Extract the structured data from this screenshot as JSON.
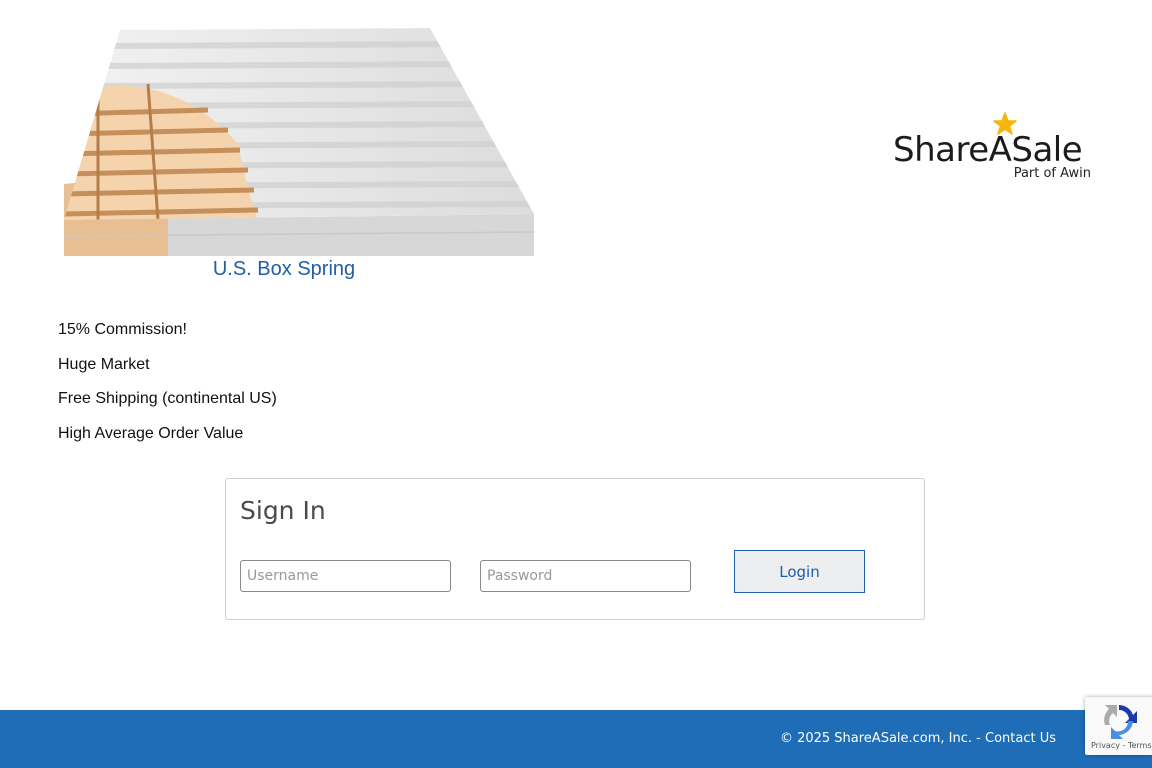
{
  "banner": {
    "caption": "U.S. Box Spring",
    "colors": {
      "caption": "#1f5fa8",
      "wood": "#e9c39b",
      "fabric": "#e3e3e3"
    }
  },
  "logo": {
    "name": "ShareASale",
    "subtitle": "Part of Awin",
    "icon": "star-icon",
    "colors": {
      "star": "#f5b50a",
      "text": "#1c1c1c"
    }
  },
  "features": [
    "15% Commission!",
    "Huge Market",
    "Free Shipping (continental US)",
    "High Average Order Value"
  ],
  "signin": {
    "title": "Sign In",
    "username_placeholder": "Username",
    "password_placeholder": "Password",
    "login_label": "Login"
  },
  "footer": {
    "copyright": "© 2025 ShareASale.com, Inc. - ",
    "contact_label": "Contact Us",
    "color": "#1e6db6"
  },
  "recaptcha": {
    "icon": "recaptcha-icon",
    "privacy_label": "Privacy",
    "separator": " - ",
    "terms_label": "Terms"
  }
}
